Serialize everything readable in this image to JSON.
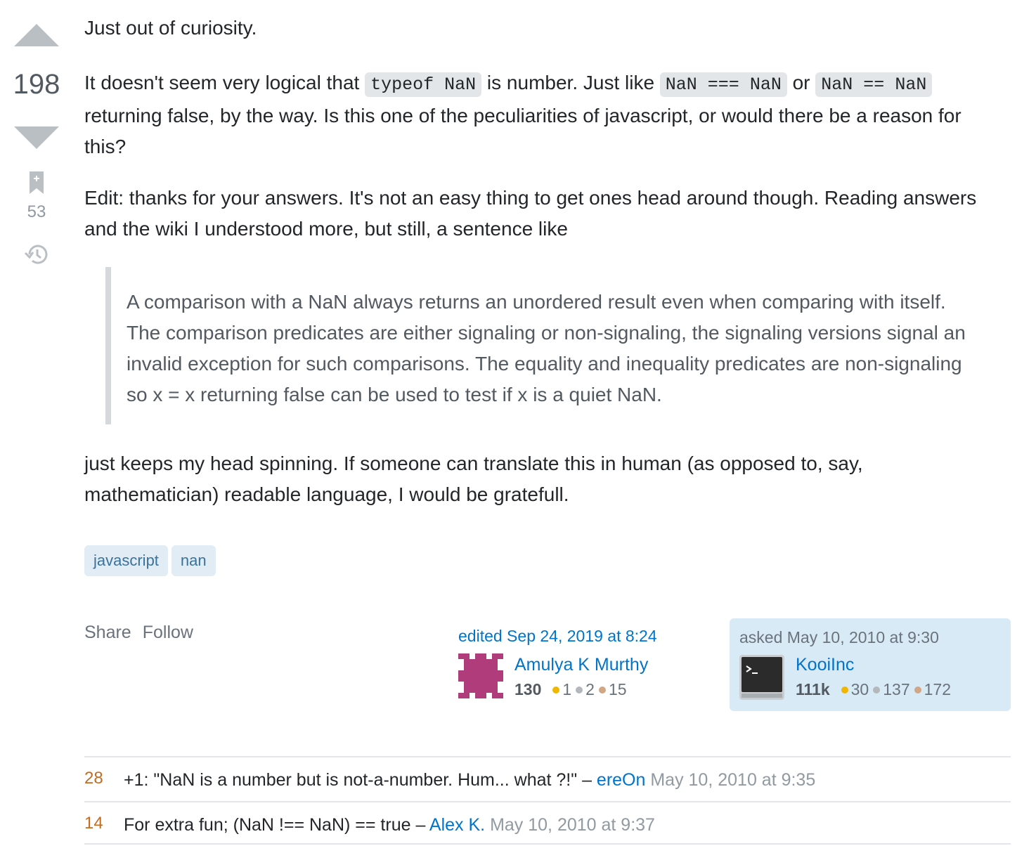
{
  "vote": {
    "score": "198",
    "bookmark_count": "53"
  },
  "post": {
    "p1": "Just out of curiosity.",
    "p2_a": "It doesn't seem very logical that ",
    "p2_code1": "typeof NaN",
    "p2_b": " is number. Just like ",
    "p2_code2": "NaN === NaN",
    "p2_c": " or ",
    "p2_code3": "NaN == NaN",
    "p2_d": " returning false, by the way. Is this one of the peculiarities of javascript, or would there be a reason for this?",
    "p3": "Edit: thanks for your answers. It's not an easy thing to get ones head around though. Reading answers and the wiki I understood more, but still, a sentence like",
    "quote": "A comparison with a NaN always returns an unordered result even when comparing with itself. The comparison predicates are either signaling or non-signaling, the signaling versions signal an invalid exception for such comparisons. The equality and inequality predicates are non-signaling so x = x returning false can be used to test if x is a quiet NaN.",
    "p4": "just keeps my head spinning. If someone can translate this in human (as opposed to, say, mathematician) readable language, I would be gratefull."
  },
  "tags": [
    "javascript",
    "nan"
  ],
  "menu": {
    "share": "Share",
    "follow": "Follow"
  },
  "editor": {
    "when": "edited Sep 24, 2019 at 8:24",
    "name": "Amulya K Murthy",
    "rep": "130",
    "gold": "1",
    "silver": "2",
    "bronze": "15"
  },
  "owner": {
    "when": "asked May 10, 2010 at 9:30",
    "name": "KooiInc",
    "rep": "111k",
    "gold": "30",
    "silver": "137",
    "bronze": "172"
  },
  "comments": [
    {
      "score": "28",
      "text": "+1: \"NaN is a number but is not-a-number. Hum... what ?!\" – ",
      "user": "ereOn",
      "date": " May 10, 2010 at 9:35"
    },
    {
      "score": "14",
      "text": "For extra fun; (NaN !== NaN) == true – ",
      "user": "Alex K.",
      "date": " May 10, 2010 at 9:37"
    }
  ],
  "colors": {
    "accent": "#0074cc",
    "tag_bg": "#e1ecf4",
    "owner_bg": "#d9eaf7",
    "comment_score": "#c46c1f"
  }
}
